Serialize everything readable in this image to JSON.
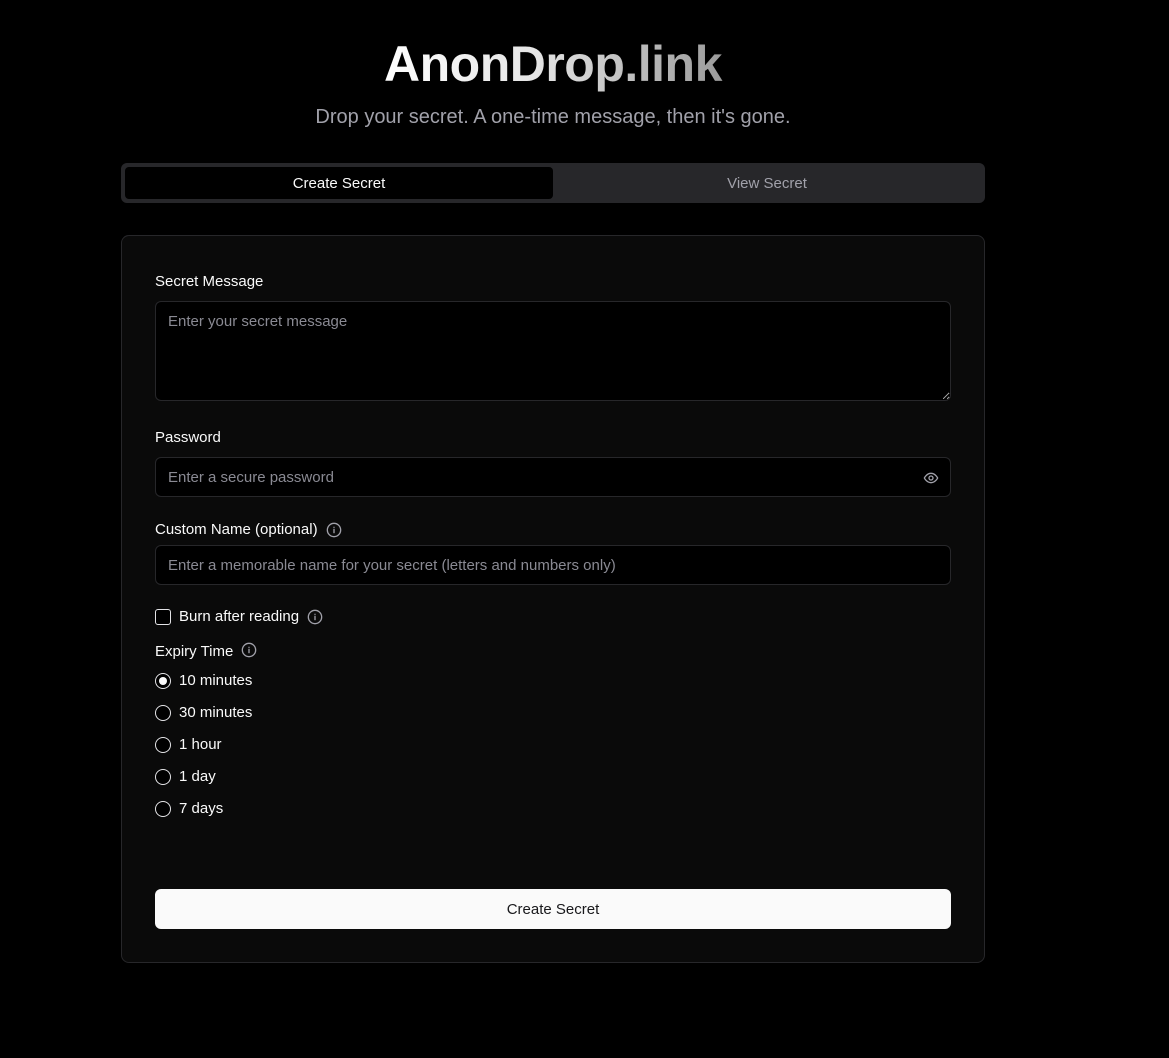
{
  "header": {
    "title": "AnonDrop.link",
    "subtitle": "Drop your secret. A one-time message, then it's gone."
  },
  "tabs": [
    {
      "label": "Create Secret",
      "active": true
    },
    {
      "label": "View Secret",
      "active": false
    }
  ],
  "form": {
    "message": {
      "label": "Secret Message",
      "placeholder": "Enter your secret message",
      "value": ""
    },
    "password": {
      "label": "Password",
      "placeholder": "Enter a secure password",
      "value": "",
      "icon": "eye-icon"
    },
    "custom_name": {
      "label": "Custom Name (optional)",
      "placeholder": "Enter a memorable name for your secret (letters and numbers only)",
      "value": "",
      "icon": "info-icon"
    },
    "burn": {
      "label": "Burn after reading",
      "checked": false,
      "icon": "info-icon"
    },
    "expiry": {
      "label": "Expiry Time",
      "icon": "info-icon",
      "options": [
        {
          "label": "10 minutes",
          "selected": true
        },
        {
          "label": "30 minutes",
          "selected": false
        },
        {
          "label": "1 hour",
          "selected": false
        },
        {
          "label": "1 day",
          "selected": false
        },
        {
          "label": "7 days",
          "selected": false
        }
      ]
    },
    "submit_label": "Create Secret"
  },
  "colors": {
    "background": "#000000",
    "card": "#0a0a0a",
    "border": "#27272a",
    "muted_text": "#a1a1aa",
    "button": "#fafafa"
  }
}
